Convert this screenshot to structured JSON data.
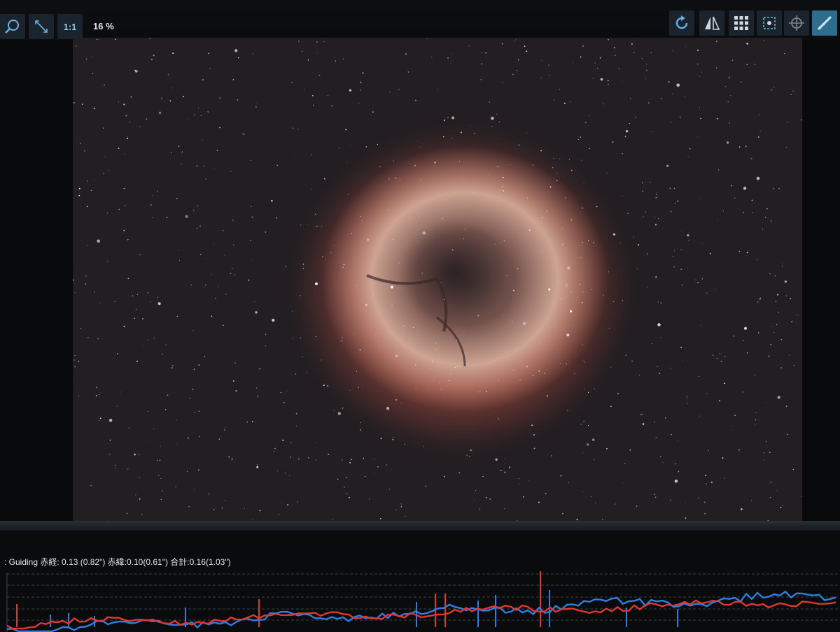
{
  "toolbar": {
    "zoom_in_icon": "zoom-in-icon",
    "fit_icon": "fit-to-screen-icon",
    "one_to_one_label": "1:1",
    "zoom_percent": "16 %",
    "right_icons": [
      "rotate-icon",
      "flip-icon",
      "grid-icon",
      "star-detect-icon",
      "crosshair-icon",
      "measure-icon"
    ]
  },
  "guiding": {
    "status_text": ": Guiding 赤経: 0.13 (0.82\") 赤緯:0.10(0.61\") 合計:0.16(1.03\")"
  },
  "colors": {
    "ra_line": "#2f7fe0",
    "dec_line": "#e0382f",
    "accent": "#2f6d8f"
  }
}
